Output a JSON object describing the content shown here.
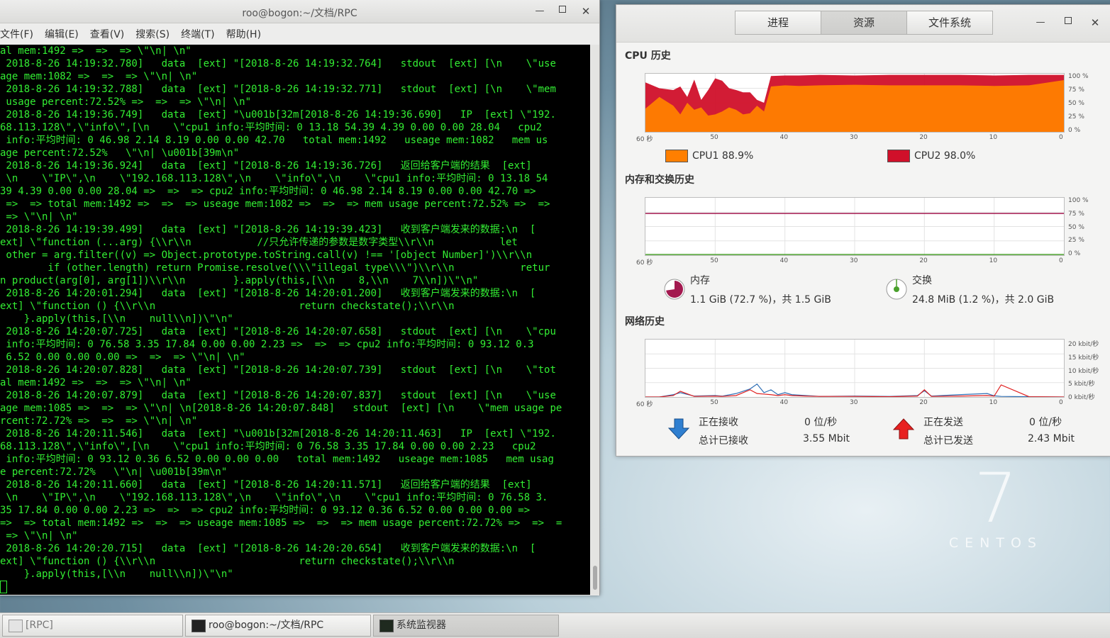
{
  "terminal": {
    "title": "roo@bogon:~/文档/RPC",
    "menu": [
      "文件(F)",
      "编辑(E)",
      "查看(V)",
      "搜索(S)",
      "终端(T)",
      "帮助(H)"
    ],
    "lines": [
      "al mem:1492 =>  =>  => \\\"\\n| \\n\"",
      " 2018-8-26 14:19:32.780]   data  [ext] \"[2018-8-26 14:19:32.764]   stdout  [ext] [\\n    \\\"use",
      "age mem:1082 =>  =>  => \\\"\\n| \\n\"",
      " 2018-8-26 14:19:32.788]   data  [ext] \"[2018-8-26 14:19:32.771]   stdout  [ext] [\\n    \\\"mem",
      " usage percent:72.52% =>  =>  => \\\"\\n| \\n\"",
      " 2018-8-26 14:19:36.749]   data  [ext] \"\\u001b[32m[2018-8-26 14:19:36.690]   IP  [ext] \\\"192.",
      "68.113.128\\\",\\\"info\\\",[\\n    \\\"cpu1 info:平均时间: 0 13.18 54.39 4.39 0.00 0.00 28.04   cpu2",
      " info:平均时间: 0 46.98 2.14 8.19 0.00 0.00 42.70   total mem:1492   useage mem:1082   mem us",
      "age percent:72.52%   \\\"\\n| \\u001b[39m\\n\"",
      " 2018-8-26 14:19:36.924]   data  [ext] \"[2018-8-26 14:19:36.726]   返回给客户端的结果  [ext]",
      " \\n    \\\"IP\\\",\\n    \\\"192.168.113.128\\\",\\n    \\\"info\\\",\\n    \\\"cpu1 info:平均时间: 0 13.18 54",
      "39 4.39 0.00 0.00 28.04 =>  =>  => cpu2 info:平均时间: 0 46.98 2.14 8.19 0.00 0.00 42.70 =>",
      " =>  => total mem:1492 =>  =>  => useage mem:1082 =>  =>  => mem usage percent:72.52% =>  =>",
      " => \\\"\\n| \\n\"",
      " 2018-8-26 14:19:39.499]   data  [ext] \"[2018-8-26 14:19:39.423]   收到客户端发来的数据:\\n  [",
      "ext] \\\"function (...arg) {\\\\r\\\\n           //只允许传递的参数是数字类型\\\\r\\\\n           let",
      " other = arg.filter((v) => Object.prototype.toString.call(v) !== '[object Number]')\\\\r\\\\n",
      "        if (other.length) return Promise.resolve(\\\\\\\"illegal type\\\\\\\")\\\\r\\\\n           retur",
      "n product(arg[0], arg[1])\\\\r\\\\n        }.apply(this,[\\\\n    8,\\\\n    7\\\\n])\\\"\\n\"",
      " 2018-8-26 14:20:01.294]   data  [ext] \"[2018-8-26 14:20:01.200]   收到客户端发来的数据:\\n  [",
      "ext] \\\"function () {\\\\r\\\\n                        return checkstate();\\\\r\\\\n",
      "    }.apply(this,[\\\\n    null\\\\n])\\\"\\n\"",
      " 2018-8-26 14:20:07.725]   data  [ext] \"[2018-8-26 14:20:07.658]   stdout  [ext] [\\n    \\\"cpu",
      " info:平均时间: 0 76.58 3.35 17.84 0.00 0.00 2.23 =>  =>  => cpu2 info:平均时间: 0 93.12 0.3",
      " 6.52 0.00 0.00 0.00 =>  =>  => \\\"\\n| \\n\"",
      " 2018-8-26 14:20:07.828]   data  [ext] \"[2018-8-26 14:20:07.739]   stdout  [ext] [\\n    \\\"tot",
      "al mem:1492 =>  =>  => \\\"\\n| \\n\"",
      " 2018-8-26 14:20:07.879]   data  [ext] \"[2018-8-26 14:20:07.837]   stdout  [ext] [\\n    \\\"use",
      "age mem:1085 =>  =>  => \\\"\\n| \\n[2018-8-26 14:20:07.848]   stdout  [ext] [\\n    \\\"mem usage pe",
      "rcent:72.72% =>  =>  => \\\"\\n| \\n\"",
      " 2018-8-26 14:20:11.546]   data  [ext] \"\\u001b[32m[2018-8-26 14:20:11.463]   IP  [ext] \\\"192.",
      "68.113.128\\\",\\\"info\\\",[\\n    \\\"cpu1 info:平均时间: 0 76.58 3.35 17.84 0.00 0.00 2.23   cpu2",
      " info:平均时间: 0 93.12 0.36 6.52 0.00 0.00 0.00   total mem:1492   useage mem:1085   mem usag",
      "e percent:72.72%   \\\"\\n| \\u001b[39m\\n\"",
      " 2018-8-26 14:20:11.660]   data  [ext] \"[2018-8-26 14:20:11.571]   返回给客户端的结果  [ext]",
      " \\n    \\\"IP\\\",\\n    \\\"192.168.113.128\\\",\\n    \\\"info\\\",\\n    \\\"cpu1 info:平均时间: 0 76.58 3.",
      "35 17.84 0.00 0.00 2.23 =>  =>  => cpu2 info:平均时间: 0 93.12 0.36 6.52 0.00 0.00 0.00 =>",
      "=>  => total mem:1492 =>  =>  => useage mem:1085 =>  =>  => mem usage percent:72.72% =>  =>  =",
      " => \\\"\\n| \\n\"",
      " 2018-8-26 14:20:20.715]   data  [ext] \"[2018-8-26 14:20:20.654]   收到客户端发来的数据:\\n  [",
      "ext] \\\"function () {\\\\r\\\\n                        return checkstate();\\\\r\\\\n",
      "    }.apply(this,[\\\\n    null\\\\n])\\\"\\n\""
    ],
    "colors": {
      "text": "#33ee33",
      "background": "#000000"
    }
  },
  "monitor": {
    "tabs": [
      "进程",
      "资源",
      "文件系统"
    ],
    "active_tab": 1,
    "cpu": {
      "title": "CPU 历史",
      "legend": [
        {
          "label": "CPU1 88.9%",
          "color": "#ff7f00"
        },
        {
          "label": "CPU2 98.0%",
          "color": "#d0102a"
        }
      ]
    },
    "memory": {
      "title": "内存和交换历史",
      "mem_label": "内存",
      "mem_value": "1.1 GiB (72.7 %)，共 1.5 GiB",
      "swap_label": "交换",
      "swap_value": "24.8 MiB (1.2 %)，共 2.0 GiB",
      "mem_fraction": 0.727,
      "swap_fraction": 0.012,
      "mem_color": "#a3194f",
      "swap_color": "#4aa02c"
    },
    "network": {
      "title": "网络历史",
      "receiving_label": "正在接收",
      "receiving_rate": "0 位/秒",
      "total_received_label": "总计已接收",
      "total_received": "3.55 Mbit",
      "sending_label": "正在发送",
      "sending_rate": "0 位/秒",
      "total_sent_label": "总计已发送",
      "total_sent": "2.43 Mbit",
      "recv_color": "#2f6fb5",
      "send_color": "#e02020"
    },
    "percent_ticks": [
      "100 %",
      "75 %",
      "50 %",
      "25 %",
      "0 %"
    ],
    "net_ticks": [
      "20 kbit/秒",
      "15 kbit/秒",
      "10 kbit/秒",
      "5 kbit/秒",
      "0 kbit/秒"
    ],
    "x_ticks": [
      "60 秒",
      "50",
      "40",
      "30",
      "20",
      "10",
      "0"
    ]
  },
  "chart_data": [
    {
      "type": "area",
      "title": "CPU 历史",
      "x": [
        60,
        58,
        56,
        55,
        54,
        53,
        52,
        51,
        50,
        49,
        48,
        47,
        46,
        45,
        44,
        43,
        42,
        40,
        38,
        35,
        30,
        25,
        20,
        15,
        10,
        5,
        0
      ],
      "series": [
        {
          "name": "CPU1 88.9%",
          "values": [
            40,
            60,
            45,
            30,
            50,
            38,
            42,
            28,
            30,
            35,
            42,
            38,
            30,
            32,
            45,
            35,
            78,
            80,
            79,
            80,
            81,
            80,
            80,
            80,
            79,
            80,
            89
          ]
        },
        {
          "name": "CPU2 98.0%",
          "values": [
            85,
            75,
            72,
            78,
            60,
            90,
            55,
            72,
            92,
            88,
            75,
            72,
            68,
            68,
            55,
            50,
            96,
            97,
            97,
            98,
            97,
            98,
            98,
            98,
            97,
            98,
            98
          ]
        }
      ],
      "xlabel": "",
      "ylabel": "",
      "ylim": [
        0,
        100
      ]
    },
    {
      "type": "line",
      "title": "内存和交换历史",
      "x": [
        60,
        0
      ],
      "series": [
        {
          "name": "内存",
          "values": [
            72.7,
            72.7
          ]
        },
        {
          "name": "交换",
          "values": [
            1.2,
            1.2
          ]
        }
      ],
      "ylim": [
        0,
        100
      ]
    },
    {
      "type": "line",
      "title": "网络历史",
      "x": [
        60,
        58,
        56,
        55,
        53,
        50,
        49,
        47,
        45,
        44,
        43,
        42,
        41,
        40,
        39,
        37,
        35,
        30,
        25,
        21,
        20,
        19,
        15,
        11,
        10,
        9,
        5,
        0
      ],
      "series": [
        {
          "name": "正在接收",
          "values": [
            0,
            0,
            0.8,
            1.5,
            0.3,
            0.5,
            0.3,
            1.2,
            2.8,
            4.5,
            1.5,
            2.5,
            0.8,
            1.5,
            0.8,
            0.5,
            0.2,
            0.3,
            0.2,
            0.5,
            2.2,
            0.3,
            0.8,
            1.2,
            0.4,
            0.2,
            0.1,
            0
          ]
        },
        {
          "name": "正在发送",
          "values": [
            0,
            0,
            0.5,
            2.0,
            0.2,
            0.3,
            0.2,
            0.5,
            2.5,
            1.2,
            1.0,
            0.8,
            0.5,
            0.8,
            0.5,
            0.3,
            0.2,
            0.2,
            0.1,
            0.3,
            2.5,
            0.2,
            0.3,
            0.5,
            0.3,
            4.2,
            0.1,
            0
          ]
        }
      ],
      "ylim": [
        0,
        20
      ]
    }
  ],
  "taskbar": {
    "items": [
      {
        "label": "[RPC]"
      },
      {
        "label": "roo@bogon:~/文档/RPC"
      },
      {
        "label": "系统监视器"
      }
    ]
  },
  "desktop": {
    "logo_number": "7",
    "logo_text": "CENTOS"
  }
}
